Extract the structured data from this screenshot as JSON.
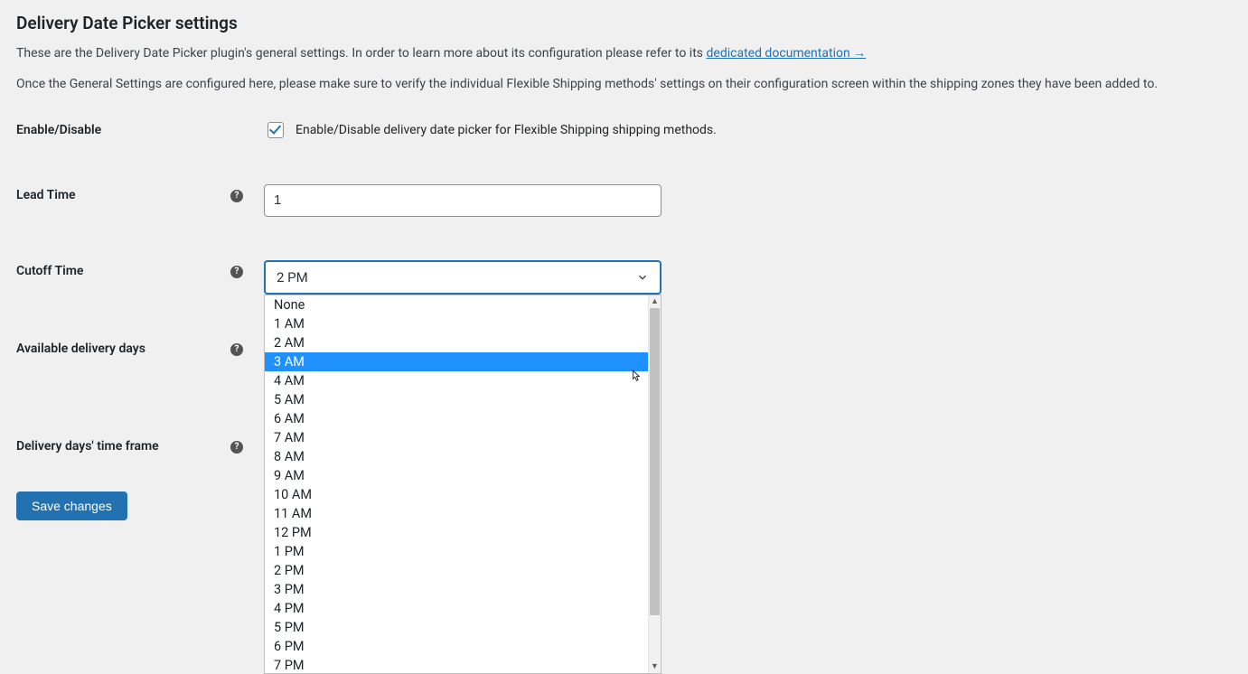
{
  "page": {
    "title": "Delivery Date Picker settings",
    "intro_before_link": "These are the Delivery Date Picker plugin's general settings. In order to learn more about its configuration please refer to its ",
    "doc_link_text": "dedicated documentation →",
    "intro_para2": "Once the General Settings are configured here, please make sure to verify the individual Flexible Shipping methods' settings on their configuration screen within the shipping zones they have been added to."
  },
  "fields": {
    "enable": {
      "label": "Enable/Disable",
      "desc": "Enable/Disable delivery date picker for Flexible Shipping shipping methods.",
      "checked": true
    },
    "lead_time": {
      "label": "Lead Time",
      "value": "1"
    },
    "cutoff": {
      "label": "Cutoff Time",
      "selected": "2 PM",
      "highlighted_option": "3 AM",
      "options": [
        "None",
        "1 AM",
        "2 AM",
        "3 AM",
        "4 AM",
        "5 AM",
        "6 AM",
        "7 AM",
        "8 AM",
        "9 AM",
        "10 AM",
        "11 AM",
        "12 PM",
        "1 PM",
        "2 PM",
        "3 PM",
        "4 PM",
        "5 PM",
        "6 PM",
        "7 PM"
      ]
    },
    "available_days": {
      "label": "Available delivery days"
    },
    "time_frame": {
      "label": "Delivery days' time frame"
    }
  },
  "buttons": {
    "save": "Save changes"
  },
  "help_glyph": "?"
}
